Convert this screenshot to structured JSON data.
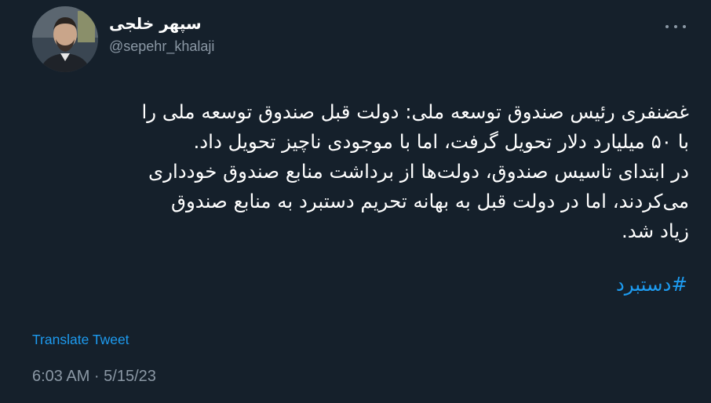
{
  "author": {
    "display_name": "سپهر خلجی",
    "handle": "@sepehr_khalaji"
  },
  "more_icon": "more-horizontal-icon",
  "tweet": {
    "lines": [
      "غضنفری رئیس صندوق توسعه ملی: دولت قبل صندوق توسعه ملی را",
      "با ۵۰ میلیارد دلار تحویل گرفت، اما با موجودی ناچیز تحویل داد.",
      "در ابتدای تاسیس صندوق، دولت‌ها از برداشت منابع صندوق خودداری",
      "می‌کردند، اما در دولت قبل به بهانه تحریم دستبرد به منابع صندوق",
      "زیاد شد."
    ],
    "hashtag": "#دستبرد"
  },
  "translate_label": "Translate Tweet",
  "timestamp": "6:03 AM · 5/15/23",
  "colors": {
    "background": "#15202b",
    "text": "#ffffff",
    "secondary": "#8b98a5",
    "accent": "#1d9bf0"
  }
}
